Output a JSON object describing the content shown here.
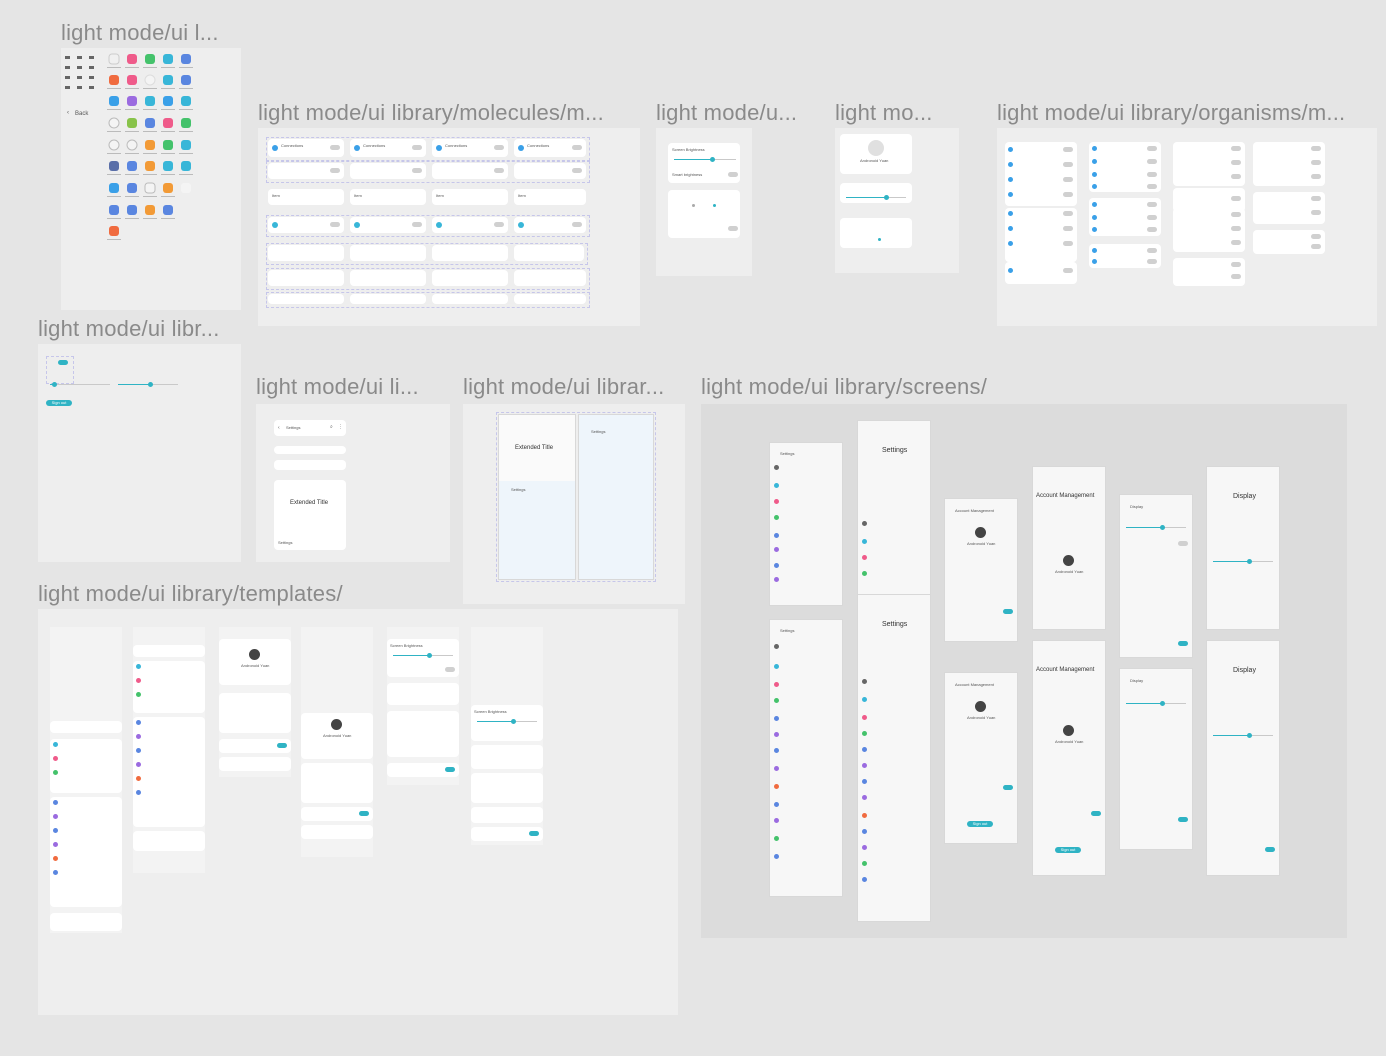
{
  "sections": {
    "icons": "light mode/ui l...",
    "molecules": "light mode/ui library/molecules/m...",
    "u_panel": "light mode/u...",
    "mo_panel": "light mo...",
    "organisms": "light mode/ui library/organisms/m...",
    "libr": "light mode/ui libr...",
    "li": "light mode/ui li...",
    "librar": "light mode/ui librar...",
    "screens": "light mode/ui library/screens/",
    "templates": "light mode/ui library/templates/"
  },
  "labels": {
    "back": "Back",
    "settings": "Settings",
    "extended_title": "Extended Title",
    "account_management": "Account Management",
    "display": "Display",
    "andronoid_yuan": "Andronoid Yuan",
    "connections": "Connections",
    "screen_brightness": "Screen Brightness",
    "smart_brightness": "Smart brightness",
    "sign_out": "Sign out",
    "item": "Item"
  },
  "colors": {
    "accent": "#2fb3c4",
    "section_title": "#8a8a8a",
    "canvas": "#e5e5e5"
  }
}
